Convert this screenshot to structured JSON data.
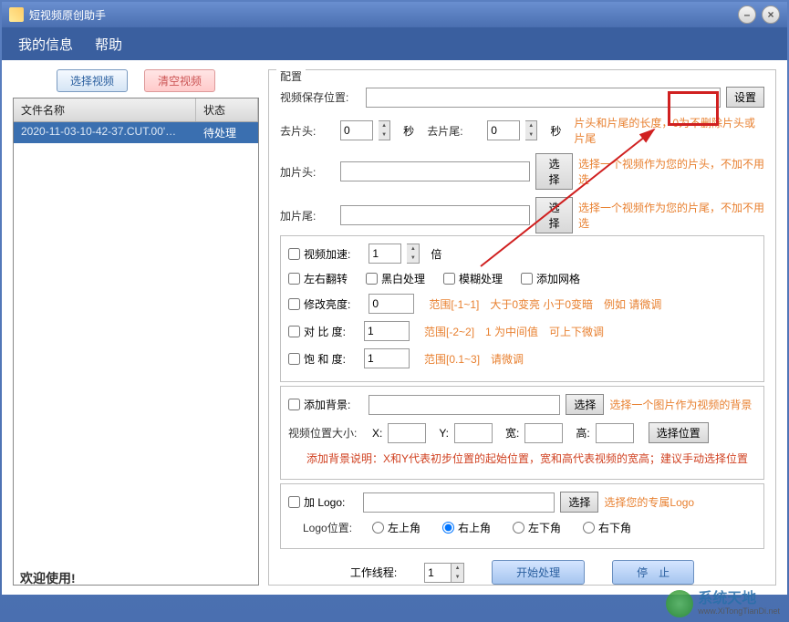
{
  "title": "短视频原创助手",
  "menu": {
    "my_info": "我的信息",
    "help": "帮助"
  },
  "left": {
    "select_video": "选择视频",
    "clear_video": "清空视频",
    "col_filename": "文件名称",
    "col_status": "状态",
    "row_file": "2020-11-03-10-42-37.CUT.00'…",
    "row_status": "待处理"
  },
  "config": {
    "legend": "配置",
    "save_location_label": "视频保存位置:",
    "save_location_value": "",
    "set_button": "设置",
    "trim_head_label": "去片头:",
    "trim_head_value": "0",
    "trim_tail_label": "去片尾:",
    "trim_tail_value": "0",
    "seconds": "秒",
    "trim_hint": "片头和片尾的长度，0为不删除片头或片尾",
    "add_head_label": "加片头:",
    "add_head_value": "",
    "choose": "选择",
    "add_head_hint": "选择一个视频作为您的片头，不加不用选",
    "add_tail_label": "加片尾:",
    "add_tail_value": "",
    "add_tail_hint": "选择一个视频作为您的片尾，不加不用选",
    "speed_label": "视频加速:",
    "speed_value": "1",
    "speed_unit": "倍",
    "flip_label": "左右翻转",
    "bw_label": "黑白处理",
    "blur_label": "模糊处理",
    "grid_label": "添加网格",
    "brightness_label": "修改亮度:",
    "brightness_value": "0",
    "brightness_hint": "范围[-1~1]　大于0变亮 小于0变暗　例如 请微调",
    "contrast_label": "对 比  度:",
    "contrast_value": "1",
    "contrast_hint": "范围[-2~2]　1 为中间值　可上下微调",
    "saturation_label": "饱 和  度:",
    "saturation_value": "1",
    "saturation_hint": "范围[0.1~3]　请微调",
    "bg_label": "添加背景:",
    "bg_value": "",
    "bg_hint": "选择一个图片作为视频的背景",
    "pos_size_label": "视频位置大小:",
    "x_label": "X:",
    "x_value": "",
    "y_label": "Y:",
    "y_value": "",
    "w_label": "宽:",
    "w_value": "",
    "h_label": "高:",
    "h_value": "",
    "pos_button": "选择位置",
    "bg_note": "添加背景说明：X和Y代表初步位置的起始位置，宽和高代表视频的宽高；建议手动选择位置",
    "logo_label": "加 Logo:",
    "logo_value": "",
    "logo_hint": "选择您的专属Logo",
    "logo_pos_label": "Logo位置:",
    "pos_tl": "左上角",
    "pos_tr": "右上角",
    "pos_bl": "左下角",
    "pos_br": "右下角",
    "threads_label": "工作线程:",
    "threads_value": "1",
    "start": "开始处理",
    "stop": "停　止"
  },
  "status": "欢迎使用!",
  "watermark": {
    "name": "系统天地",
    "url": "www.XiTongTianDi.net"
  }
}
